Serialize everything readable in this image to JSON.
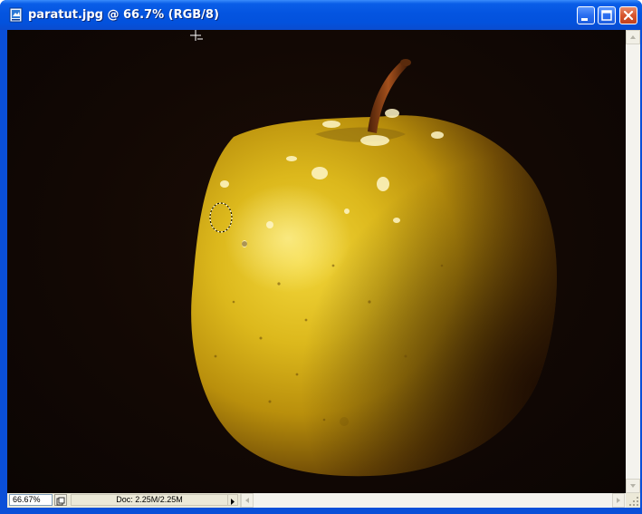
{
  "window": {
    "title": "paratut.jpg @ 66.7% (RGB/8)",
    "icons": {
      "app": "photoshop-document-icon",
      "minimize": "minimize-icon",
      "maximize": "maximize-icon",
      "close": "close-icon"
    },
    "colors": {
      "titlebar": "#0454e0",
      "close_button": "#d6552e",
      "canvas_background": "#120804",
      "apple": "#d7b01a"
    }
  },
  "canvas": {
    "image": "yellow apple with water droplets on dark background",
    "cursor": "crosshair-cursor",
    "selection": "elliptical-marquee-selection"
  },
  "status": {
    "zoom": "66.67%",
    "doc_info": "Doc: 2.25M/2.25M"
  }
}
